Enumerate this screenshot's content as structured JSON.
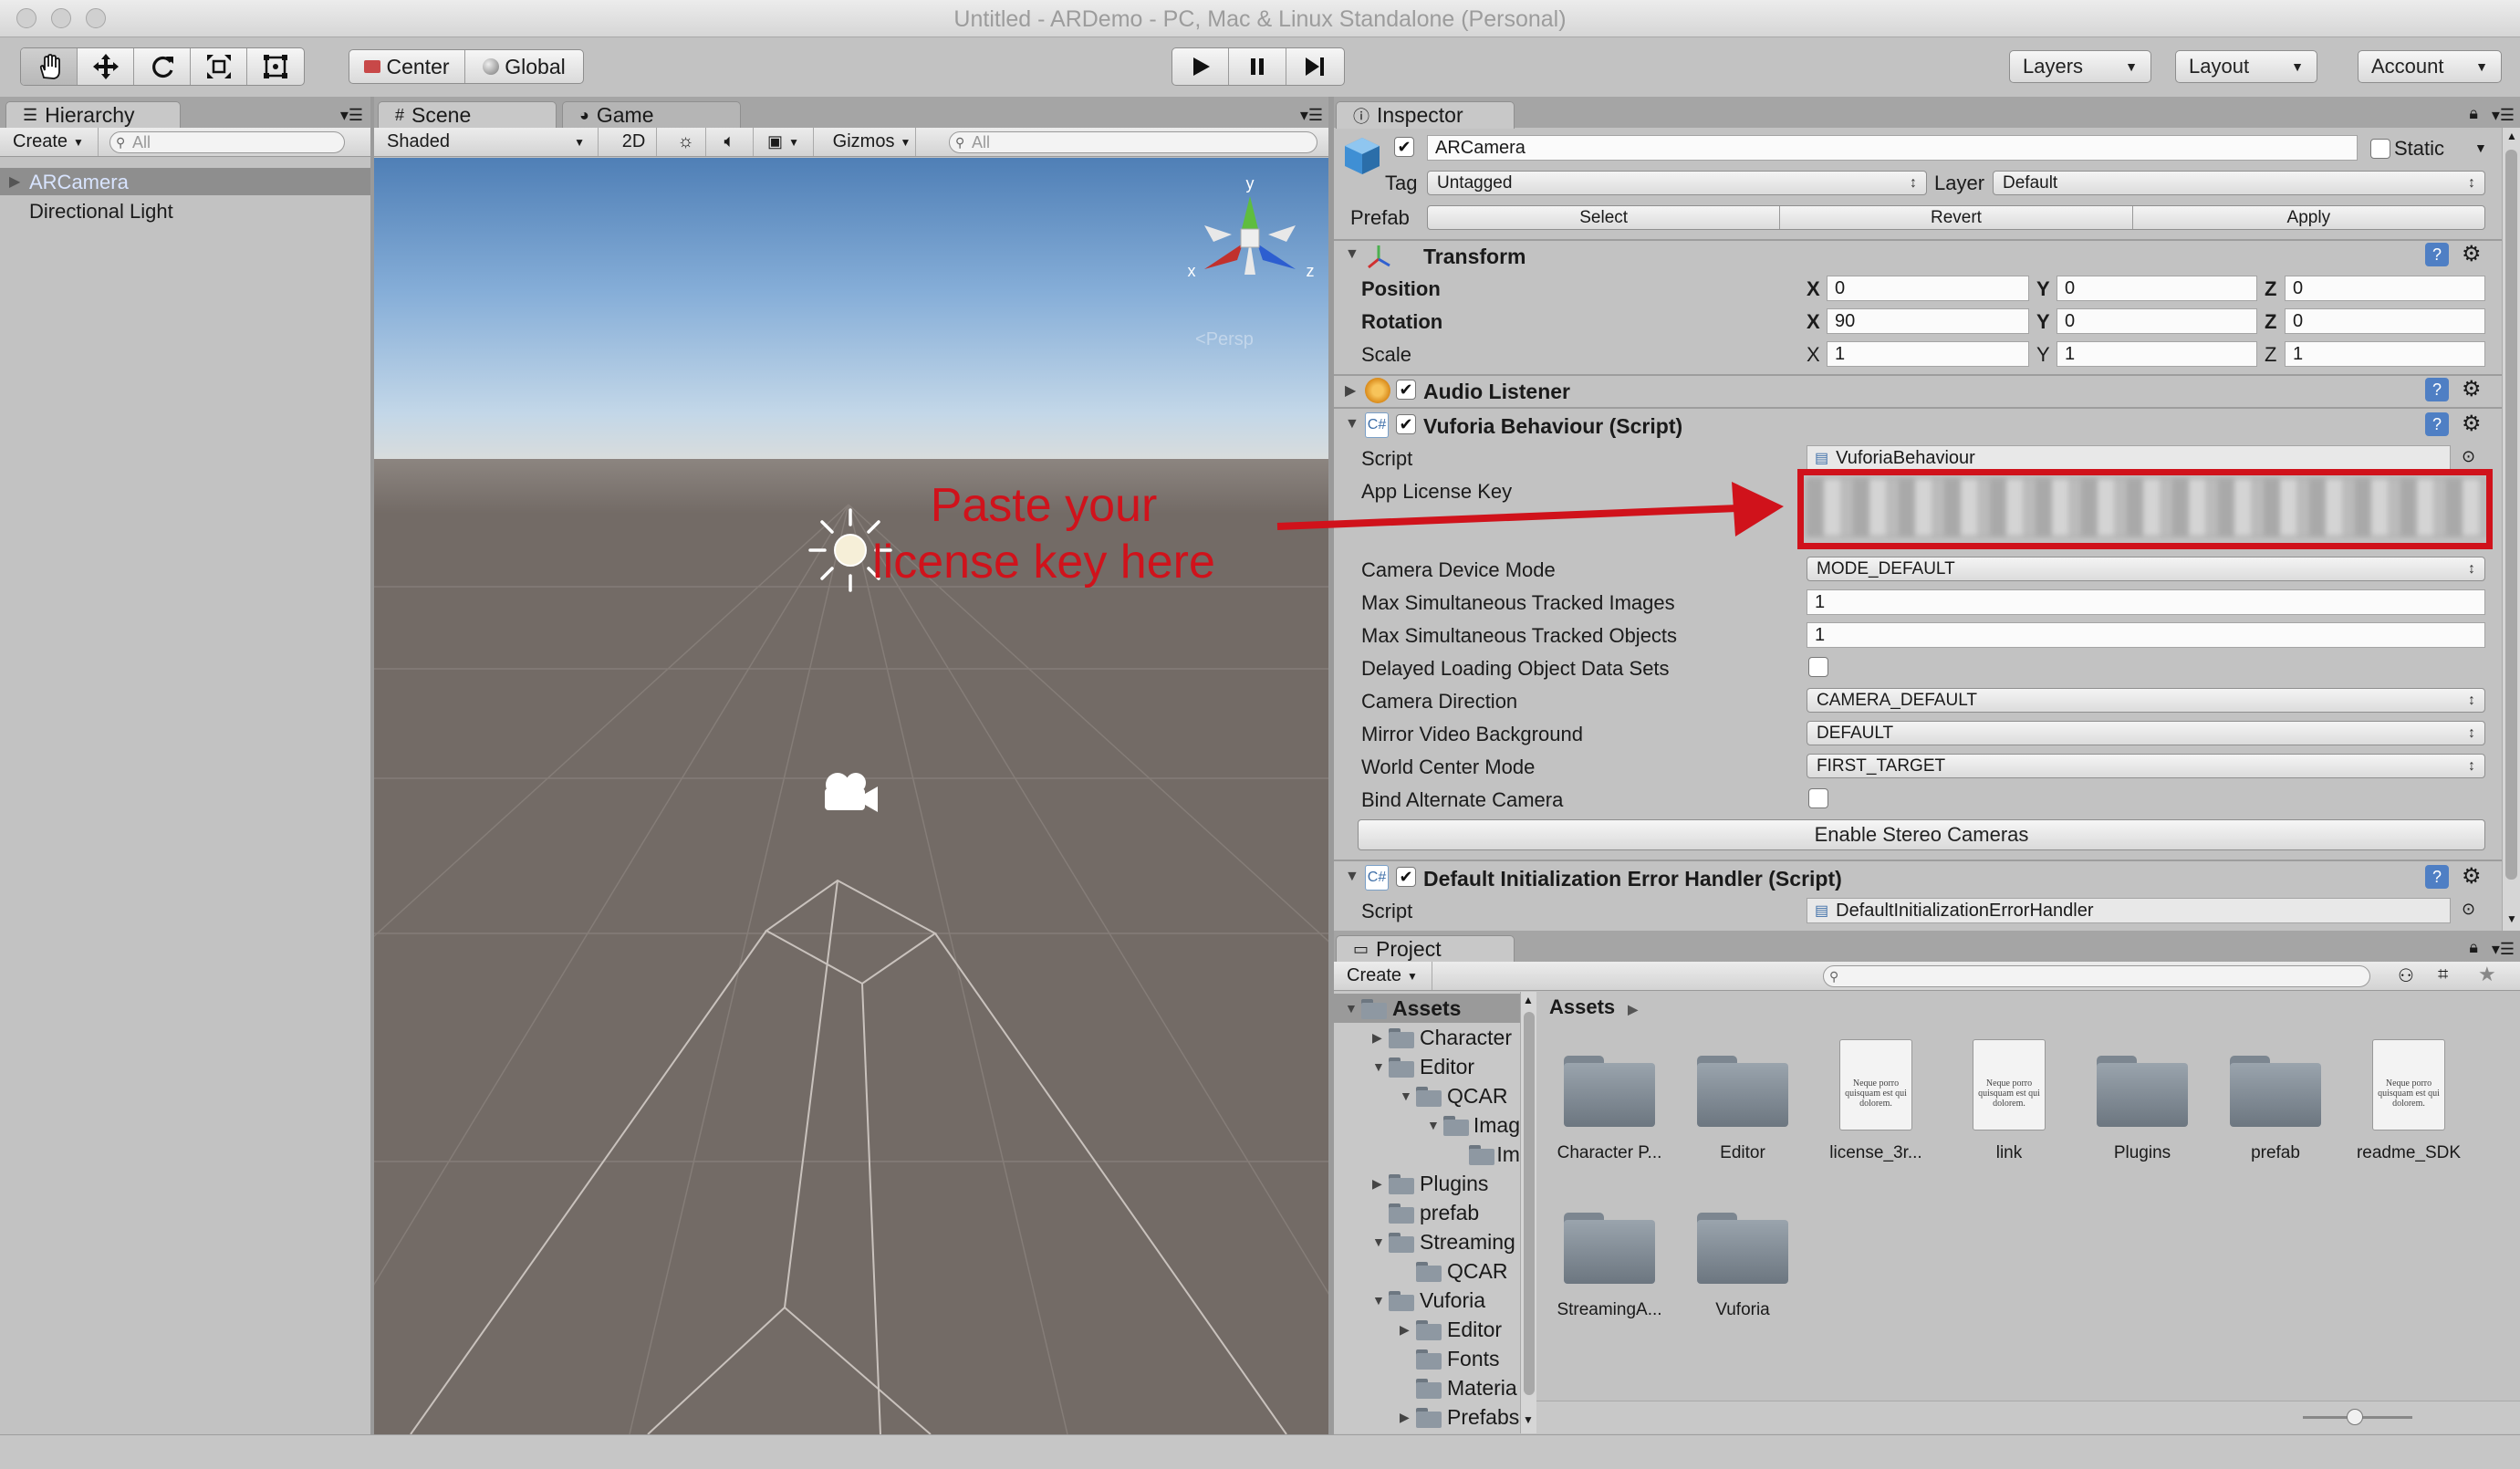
{
  "window": {
    "title": "Untitled - ARDemo - PC, Mac & Linux Standalone (Personal)"
  },
  "toolbar": {
    "tools": [
      "hand-icon",
      "move-icon",
      "rotate-icon",
      "scale-icon",
      "rect-icon"
    ],
    "center_label": "Center",
    "global_label": "Global",
    "play": [
      "play-icon",
      "pause-icon",
      "step-icon"
    ],
    "layers_label": "Layers",
    "layout_label": "Layout",
    "account_label": "Account"
  },
  "hierarchy": {
    "tab": "Hierarchy",
    "create": "Create",
    "search_placeholder": "All",
    "items": [
      "ARCamera",
      "Directional Light"
    ]
  },
  "scene": {
    "tab_scene": "Scene",
    "tab_game": "Game",
    "shading": "Shaded",
    "mode_2d": "2D",
    "gizmos": "Gizmos",
    "search_placeholder": "All",
    "gizmo_y": "y",
    "gizmo_x": "x",
    "gizmo_z": "z",
    "persp": "Persp",
    "annotation": "Paste your license key here",
    "annotation_color": "#d0121b"
  },
  "inspector": {
    "tab": "Inspector",
    "object_name": "ARCamera",
    "static_label": "Static",
    "tag_label": "Tag",
    "tag_value": "Untagged",
    "layer_label": "Layer",
    "layer_value": "Default",
    "prefab_label": "Prefab",
    "prefab_buttons": [
      "Select",
      "Revert",
      "Apply"
    ],
    "transform": {
      "title": "Transform",
      "rows": [
        {
          "label": "Position",
          "x": "0",
          "y": "0",
          "z": "0"
        },
        {
          "label": "Rotation",
          "x": "90",
          "y": "0",
          "z": "0"
        },
        {
          "label": "Scale",
          "x": "1",
          "y": "1",
          "z": "1"
        }
      ],
      "axis_x": "X",
      "axis_y": "Y",
      "axis_z": "Z"
    },
    "audio_listener": "Audio Listener",
    "vuforia": {
      "title": "Vuforia Behaviour (Script)",
      "script_label": "Script",
      "script_value": "VuforiaBehaviour",
      "app_key_label": "App License Key",
      "camera_device_mode_label": "Camera Device Mode",
      "camera_device_mode_value": "MODE_DEFAULT",
      "max_images_label": "Max Simultaneous Tracked Images",
      "max_images_value": "1",
      "max_objects_label": "Max Simultaneous Tracked Objects",
      "max_objects_value": "1",
      "delayed_label": "Delayed Loading Object Data Sets",
      "camera_direction_label": "Camera Direction",
      "camera_direction_value": "CAMERA_DEFAULT",
      "mirror_label": "Mirror Video Background",
      "mirror_value": "DEFAULT",
      "world_center_label": "World Center Mode",
      "world_center_value": "FIRST_TARGET",
      "bind_alt_label": "Bind Alternate Camera",
      "stereo_button": "Enable Stereo Cameras"
    },
    "error_handler": {
      "title": "Default Initialization Error Handler (Script)",
      "script_label": "Script",
      "script_value": "DefaultInitializationErrorHandler"
    }
  },
  "project": {
    "tab": "Project",
    "create": "Create",
    "breadcrumb": "Assets",
    "tree": [
      {
        "label": "Assets",
        "indent": 0,
        "arrow": "down",
        "selected": true
      },
      {
        "label": "Character",
        "indent": 1,
        "arrow": "right"
      },
      {
        "label": "Editor",
        "indent": 1,
        "arrow": "down"
      },
      {
        "label": "QCAR",
        "indent": 2,
        "arrow": "down"
      },
      {
        "label": "Imag",
        "indent": 3,
        "arrow": "down"
      },
      {
        "label": "Im",
        "indent": 4,
        "arrow": ""
      },
      {
        "label": "Plugins",
        "indent": 1,
        "arrow": "right"
      },
      {
        "label": "prefab",
        "indent": 1,
        "arrow": ""
      },
      {
        "label": "Streaming",
        "indent": 1,
        "arrow": "down"
      },
      {
        "label": "QCAR",
        "indent": 2,
        "arrow": ""
      },
      {
        "label": "Vuforia",
        "indent": 1,
        "arrow": "down"
      },
      {
        "label": "Editor",
        "indent": 2,
        "arrow": "right"
      },
      {
        "label": "Fonts",
        "indent": 2,
        "arrow": ""
      },
      {
        "label": "Materia",
        "indent": 2,
        "arrow": ""
      },
      {
        "label": "Prefabs",
        "indent": 2,
        "arrow": "right"
      }
    ],
    "assets": [
      {
        "name": "Character P...",
        "kind": "folder"
      },
      {
        "name": "Editor",
        "kind": "folder"
      },
      {
        "name": "license_3r...",
        "kind": "doc"
      },
      {
        "name": "link",
        "kind": "doc"
      },
      {
        "name": "Plugins",
        "kind": "folder"
      },
      {
        "name": "prefab",
        "kind": "folder"
      },
      {
        "name": "readme_SDK",
        "kind": "doc"
      },
      {
        "name": "StreamingA...",
        "kind": "folder"
      },
      {
        "name": "Vuforia",
        "kind": "folder"
      }
    ],
    "doc_preview_text": "Neque porro quisquam est qui dolorem."
  }
}
